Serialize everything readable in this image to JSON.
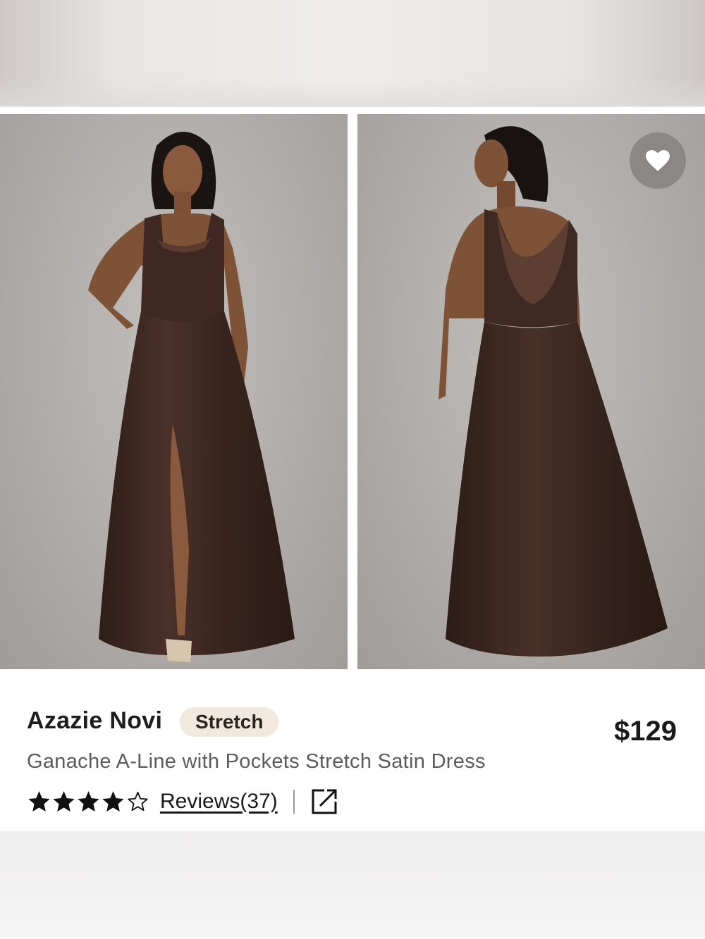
{
  "product": {
    "brand": "Azazie Novi",
    "badge": "Stretch",
    "title": "Ganache A-Line with Pockets Stretch Satin Dress",
    "price": "$129",
    "rating": 4,
    "rating_max": 5,
    "reviews_label": "Reviews(37)"
  },
  "colors": {
    "dress": "#3f2a23",
    "badge_bg": "#f1e8de",
    "backdrop": "#adaaa8"
  },
  "icons": {
    "favorite": "heart-icon",
    "share": "external-link-icon",
    "star_filled": "star-icon",
    "star_empty": "star-outline-icon"
  }
}
